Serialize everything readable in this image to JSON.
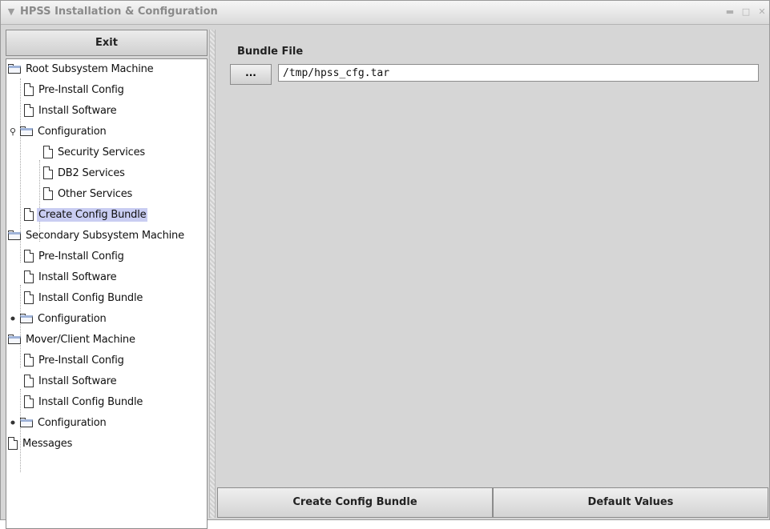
{
  "window": {
    "title": "HPSS Installation & Configuration",
    "menu_icon": "chevron-down-icon",
    "controls": [
      "minimize-icon",
      "maximize-icon",
      "close-icon"
    ]
  },
  "exit_label": "Exit",
  "tree": [
    {
      "label": "Root Subsystem Machine",
      "icon": "folder-icon"
    },
    {
      "label": "Pre-Install Config",
      "icon": "document-icon"
    },
    {
      "label": "Install Software",
      "icon": "document-icon"
    },
    {
      "label": "Configuration",
      "icon": "folder-icon",
      "expanded": true
    },
    {
      "label": "Security Services",
      "icon": "document-icon"
    },
    {
      "label": "DB2 Services",
      "icon": "document-icon"
    },
    {
      "label": "Other Services",
      "icon": "document-icon"
    },
    {
      "label": "Create Config Bundle",
      "icon": "document-icon",
      "selected": true
    },
    {
      "label": "Secondary Subsystem Machine",
      "icon": "folder-icon"
    },
    {
      "label": "Pre-Install Config",
      "icon": "document-icon"
    },
    {
      "label": "Install Software",
      "icon": "document-icon"
    },
    {
      "label": "Install Config Bundle",
      "icon": "document-icon"
    },
    {
      "label": "Configuration",
      "icon": "folder-icon",
      "expanded": false
    },
    {
      "label": "Mover/Client Machine",
      "icon": "folder-icon"
    },
    {
      "label": "Pre-Install Config",
      "icon": "document-icon"
    },
    {
      "label": "Install Software",
      "icon": "document-icon"
    },
    {
      "label": "Install Config Bundle",
      "icon": "document-icon"
    },
    {
      "label": "Configuration",
      "icon": "folder-icon",
      "expanded": false
    },
    {
      "label": "Messages",
      "icon": "document-icon"
    }
  ],
  "bundle": {
    "title": "Bundle File",
    "browse_label": "...",
    "path": "/tmp/hpss_cfg.tar"
  },
  "buttons": {
    "create": "Create Config Bundle",
    "defaults": "Default Values"
  },
  "colors": {
    "selected": "#c9cdf2",
    "panel": "#d6d6d6"
  }
}
